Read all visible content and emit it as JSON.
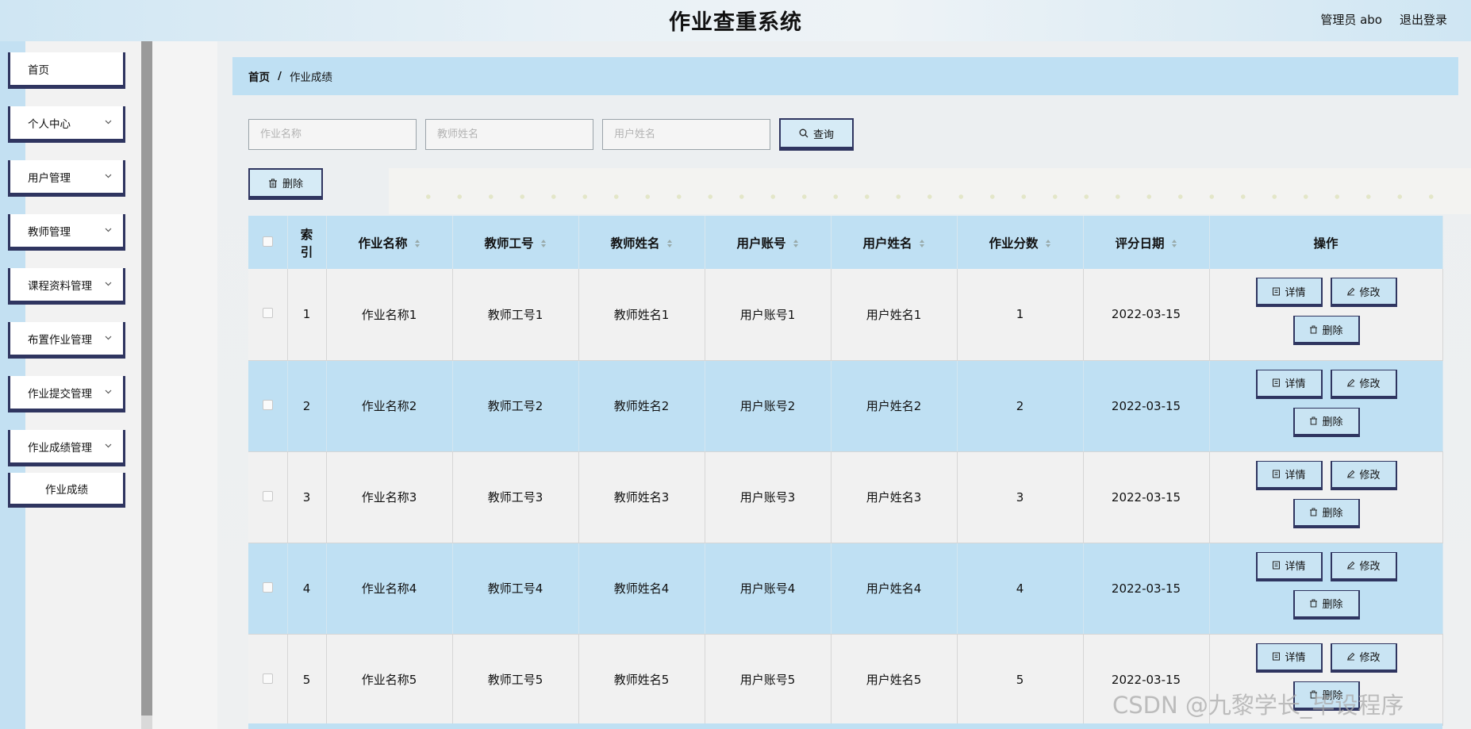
{
  "header": {
    "title": "作业查重系统",
    "user": "管理员 abo",
    "logout": "退出登录"
  },
  "sidebar": {
    "items": [
      {
        "label": "首页",
        "has_arrow": false
      },
      {
        "label": "个人中心",
        "has_arrow": true
      },
      {
        "label": "用户管理",
        "has_arrow": true
      },
      {
        "label": "教师管理",
        "has_arrow": true
      },
      {
        "label": "课程资料管理",
        "has_arrow": true
      },
      {
        "label": "布置作业管理",
        "has_arrow": true
      },
      {
        "label": "作业提交管理",
        "has_arrow": true
      },
      {
        "label": "作业成绩管理",
        "has_arrow": true
      }
    ],
    "sub_item": "作业成绩"
  },
  "breadcrumb": {
    "home": "首页",
    "separator": "/",
    "current": "作业成绩"
  },
  "search": {
    "homework_placeholder": "作业名称",
    "teacher_placeholder": "教师姓名",
    "user_placeholder": "用户姓名",
    "query_label": "查询"
  },
  "toolbar": {
    "delete_label": "删除"
  },
  "table": {
    "headers": [
      "索引",
      "作业名称",
      "教师工号",
      "教师姓名",
      "用户账号",
      "用户姓名",
      "作业分数",
      "评分日期",
      "操作"
    ],
    "index_header_top": "索",
    "index_header_bottom": "引",
    "rows": [
      {
        "index": "1",
        "name": "作业名称1",
        "teacher_no": "教师工号1",
        "teacher_name": "教师姓名1",
        "account": "用户账号1",
        "user_name": "用户姓名1",
        "score": "1",
        "date": "2022-03-15"
      },
      {
        "index": "2",
        "name": "作业名称2",
        "teacher_no": "教师工号2",
        "teacher_name": "教师姓名2",
        "account": "用户账号2",
        "user_name": "用户姓名2",
        "score": "2",
        "date": "2022-03-15"
      },
      {
        "index": "3",
        "name": "作业名称3",
        "teacher_no": "教师工号3",
        "teacher_name": "教师姓名3",
        "account": "用户账号3",
        "user_name": "用户姓名3",
        "score": "3",
        "date": "2022-03-15"
      },
      {
        "index": "4",
        "name": "作业名称4",
        "teacher_no": "教师工号4",
        "teacher_name": "教师姓名4",
        "account": "用户账号4",
        "user_name": "用户姓名4",
        "score": "4",
        "date": "2022-03-15"
      },
      {
        "index": "5",
        "name": "作业名称5",
        "teacher_no": "教师工号5",
        "teacher_name": "教师姓名5",
        "account": "用户账号5",
        "user_name": "用户姓名5",
        "score": "5",
        "date": "2022-03-15"
      }
    ],
    "actions": {
      "detail": "详情",
      "edit": "修改",
      "delete": "删除"
    }
  },
  "watermark": "CSDN @九黎学长_毕设程序",
  "colors": {
    "accent": "#2f3560",
    "light_blue": "#bfe0f3",
    "row_gray": "#f1f1f1"
  },
  "icons": [
    "search-icon",
    "trash-icon",
    "document-icon",
    "pencil-icon",
    "chevron-down-icon",
    "sort-icon",
    "cursor-icon"
  ]
}
